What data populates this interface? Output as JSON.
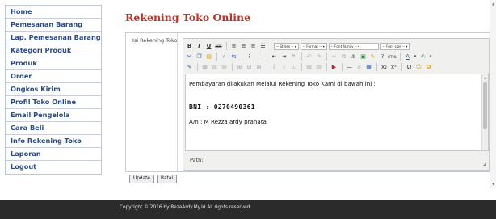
{
  "sidebar": {
    "items": [
      {
        "label": "Home"
      },
      {
        "label": "Pemesanan Barang"
      },
      {
        "label": "Lap. Pemesanan Barang"
      },
      {
        "label": "Kategori Produk"
      },
      {
        "label": "Produk"
      },
      {
        "label": "Order"
      },
      {
        "label": "Ongkos Kirim"
      },
      {
        "label": "Profil Toko Online"
      },
      {
        "label": "Email Pengelola"
      },
      {
        "label": "Cara Beli"
      },
      {
        "label": "Info Rekening Toko"
      },
      {
        "label": "Laporan"
      },
      {
        "label": "Logout"
      }
    ]
  },
  "main": {
    "title": "Rekening Toko Online",
    "field_label": "Isi Rekening Toko",
    "accent_color": "#b7322a"
  },
  "editor": {
    "toolbar": {
      "bold": "B",
      "italic": "I",
      "underline": "U",
      "strike": "ABC",
      "styles_select": "-- Styles --",
      "format_select": "-- Format --",
      "font_family_select": "-- Font family --",
      "font_size_select": "-- Font size --",
      "subscript": "x₂",
      "superscript": "x²",
      "omega": "Ω"
    },
    "content": {
      "line1": "Pembayaran dilakukan Melalui Rekening Toko Kami di bawah ini :",
      "line2": "BNI : 0270490361",
      "line3": "A/n : M Rezza ardy pranata"
    },
    "path_label": "Path:"
  },
  "buttons": {
    "update": "Update",
    "batal": "Batal"
  },
  "footer": {
    "text": "Copyright © 2016 by RezaArdy.My.Id All rights reserved."
  }
}
